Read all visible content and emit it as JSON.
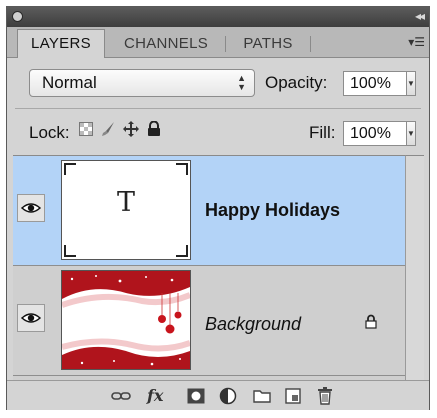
{
  "tabs": [
    "LAYERS",
    "CHANNELS",
    "PATHS"
  ],
  "controls": {
    "blend_mode": "Normal",
    "opacity_label": "Opacity:",
    "opacity_value": "100%",
    "lock_label": "Lock:",
    "fill_label": "Fill:",
    "fill_value": "100%"
  },
  "layers": [
    {
      "name": "Happy Holidays",
      "thumb_text": "T",
      "selected": true
    },
    {
      "name": "Background",
      "selected": false
    }
  ],
  "icons": {
    "panel_menu": "panel-menu-icon",
    "lock_transparent": "lock-transparent-icon",
    "lock_pixels": "brush-icon",
    "lock_position": "move-icon",
    "lock_all": "padlock-icon",
    "bottom": [
      "link-icon",
      "fx-icon",
      "mask-icon",
      "adjustment-icon",
      "folder-icon",
      "new-layer-icon",
      "trash-icon"
    ]
  },
  "colors": {
    "selection": "#b3d3f7",
    "panel": "#d4d4d4"
  },
  "footer": {
    "fx_label": "fx"
  }
}
